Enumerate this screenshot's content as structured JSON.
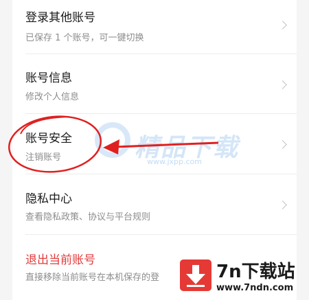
{
  "settings": {
    "items": [
      {
        "title": "登录其他账号",
        "subtitle": "已保存 1 个账号，可一键切换"
      },
      {
        "title": "账号信息",
        "subtitle": "修改个人信息"
      },
      {
        "title": "账号安全",
        "subtitle": "注销账号"
      },
      {
        "title": "隐私中心",
        "subtitle": "查看隐私政策、协议与平台规则"
      }
    ],
    "logout": {
      "title": "退出当前账号",
      "subtitle": "直接移除当前账号在本机保存的登"
    }
  },
  "watermark": {
    "text": "精品下载",
    "url": "www.jxpp.com"
  },
  "badge": {
    "title": "7n下载站",
    "url": "www.7ndn.com"
  },
  "colors": {
    "logout": "#e23b3b",
    "annotation": "#e02020",
    "badge_icon": "#e53935"
  },
  "icons": {
    "chevron": "chevron-right-icon",
    "badge": "download-arrow-icon"
  }
}
